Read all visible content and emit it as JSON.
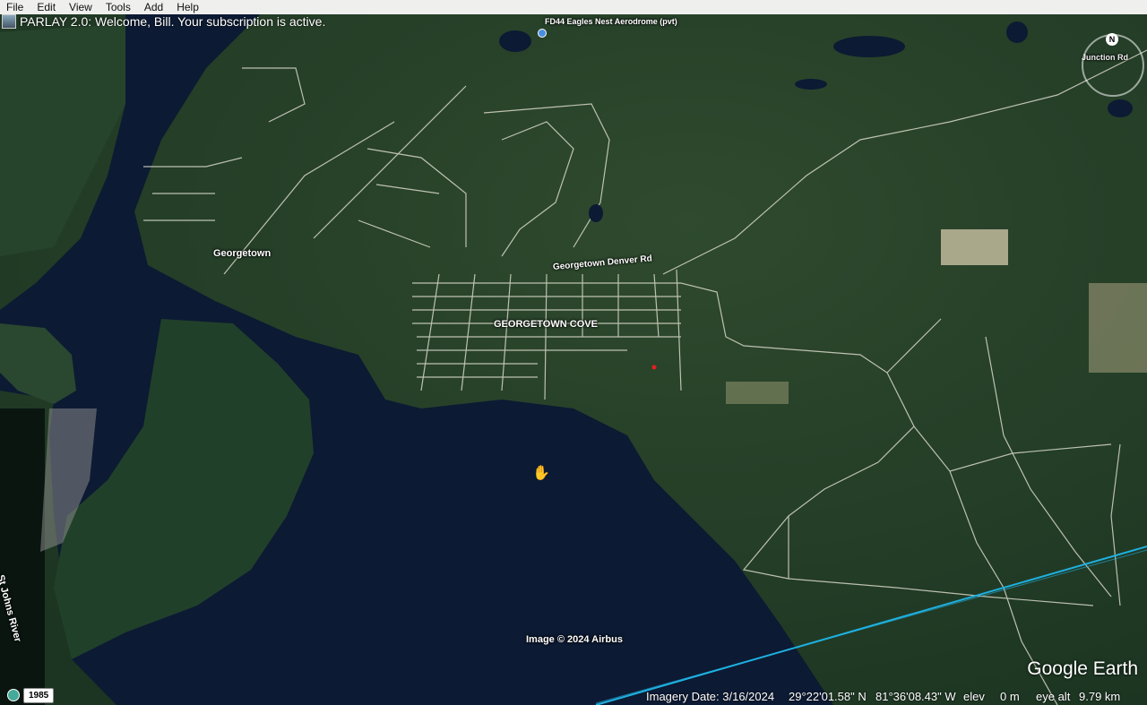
{
  "menu": [
    "File",
    "Edit",
    "View",
    "Tools",
    "Add",
    "Help"
  ],
  "welcome_message": "PARLAY 2.0: Welcome, Bill. Your subscription is active.",
  "map_labels": {
    "airport": "FD44 Eagles Nest Aerodrome (pvt)",
    "junction_rd": "Junction Rd",
    "georgetown": "Georgetown",
    "georgetown_denver_rd": "Georgetown Denver Rd",
    "georgetown_cove": "GEORGETOWN COVE",
    "st_johns_river": "St Johns River",
    "image_credit": "Image © 2024 Airbus"
  },
  "compass_north": "N",
  "logo": "Google Earth",
  "historical_year": "1985",
  "status": {
    "imagery_date": "Imagery Date: 3/16/2024",
    "latitude": "29°22'01.58\" N",
    "longitude": "81°36'08.43\" W",
    "elev_label": "elev",
    "elev_value": "0 m",
    "eye_alt_label": "eye alt",
    "eye_alt_value": "9.79 km"
  },
  "colors": {
    "water": "#0c1a33",
    "land": "#24402a",
    "forest": "#1a3320",
    "road": "#d8d8c8",
    "path_line": "#1fb0e0"
  }
}
